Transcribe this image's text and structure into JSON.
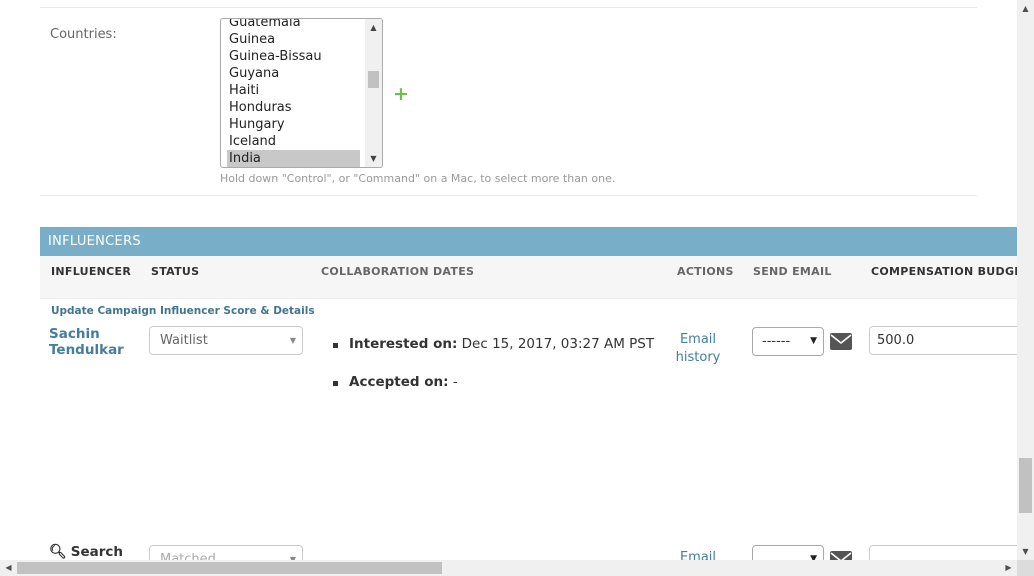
{
  "countries": {
    "label": "Countries:",
    "options": [
      "Guatemala",
      "Guinea",
      "Guinea-Bissau",
      "Guyana",
      "Haiti",
      "Honduras",
      "Hungary",
      "Iceland",
      "India"
    ],
    "selected": "India",
    "help_text": "Hold down \"Control\", or \"Command\" on a Mac, to select more than one.",
    "add_icon": "+"
  },
  "influencers": {
    "caption": "INFLUENCERS",
    "headers": {
      "influencer": "INFLUENCER",
      "status": "STATUS",
      "collaboration_dates": "COLLABORATION DATES",
      "actions": "ACTIONS",
      "send_email": "SEND EMAIL",
      "compensation_budget": "COMPENSATION BUDGE"
    },
    "update_link": "Update Campaign Influencer Score & Details",
    "rows": [
      {
        "name": "Sachin Tendulkar",
        "status": "Waitlist",
        "interested_label": "Interested on:",
        "interested_value": "Dec 15, 2017, 03:27 AM PST",
        "accepted_label": "Accepted on:",
        "accepted_value": "-",
        "action": "Email history",
        "send_email": "------",
        "compensation": "500.0"
      },
      {
        "name": "Search",
        "status": "Matched",
        "action": "Email"
      }
    ]
  },
  "icons": {
    "mail": "envelope-icon",
    "search": "magnifier-icon"
  }
}
